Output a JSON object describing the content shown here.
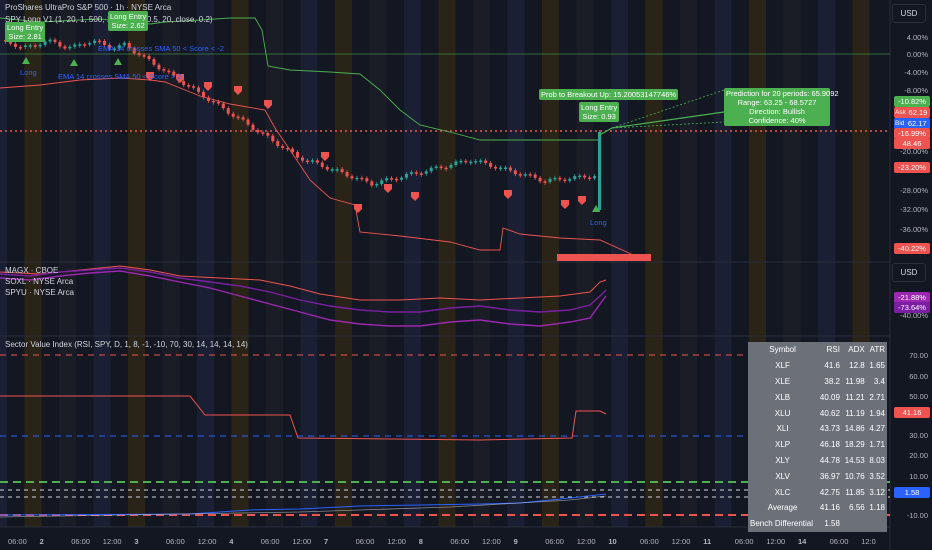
{
  "symbol_title": "ProShares UltraPro S&P 500 · 1h · NYSE Arca",
  "strategy_legend": "SPY Long V1 (1, 20, 1, 500, 14, 20, 14, 0.5, 20, close, 0.2)",
  "overlay_legend": [
    "MAGX · CBOE",
    "SOXL · NYSE Arca",
    "SPYU · NYSE Arca"
  ],
  "indicator_legend": "Sector Value Index (RSI, SPY, D, 1, 8, -1, -10, 70, 30, 14, 14, 14, 14)",
  "currency_label": "USD",
  "main_axis_ticks": [
    "4.00%",
    "0.00%",
    "-4.00%",
    "-8.00%",
    "-20.00%",
    "-24.00%",
    "-28.00%",
    "-32.00%",
    "-36.00%"
  ],
  "overlay_axis_ticks": [
    "-40.00%"
  ],
  "indicator_axis_ticks": [
    "70.00",
    "60.00",
    "50.00",
    "30.00",
    "20.00",
    "10.00",
    "0.00",
    "-10.00"
  ],
  "price_pills": [
    {
      "text": "-10.82%",
      "color": "#4caf50"
    },
    {
      "text": "62.19",
      "color": "#ef5350",
      "prefix": "Ask"
    },
    {
      "text": "62.17",
      "color": "#2962ff",
      "prefix": "Bid"
    },
    {
      "text": "-16.99%",
      "color": "#ef5350"
    },
    {
      "text": "48.46",
      "color": "#ef5350"
    },
    {
      "text": "-23.20%",
      "color": "#ef5350"
    },
    {
      "text": "-40.22%",
      "color": "#ef5350"
    }
  ],
  "overlay_pills": [
    {
      "text": "-21.88%",
      "color": "#9c27b0"
    },
    {
      "text": "-73.64%",
      "color": "#7b1fa2"
    }
  ],
  "indicator_pills": [
    {
      "text": "41.16",
      "color": "#ef5350"
    },
    {
      "text": "1.58",
      "color": "#2962ff"
    }
  ],
  "long_entry_boxes": [
    "Long Entry\nSize: 2.81",
    "Long Entry\nSize: 2.62",
    "Long Entry\nSize: 0.93"
  ],
  "prob_box": "Prob to Breakout Up: 15.20053147746%",
  "prediction_box": "Prediction for 20 periods: 65.9092\nRange: 63.25 - 68.5727\nDirection: Bullish\nConfidence: 40%",
  "chart_notes": [
    "EMA 14 crosses SMA 50 < Score > 2",
    "EMA 14 crosses SMA 50 < Score < -2",
    "Long",
    "Long"
  ],
  "time_labels": [
    "06:00",
    "2",
    "06:00",
    "12:00",
    "3",
    "06:00",
    "12:00",
    "4",
    "06:00",
    "12:00",
    "7",
    "06:00",
    "12:00",
    "8",
    "06:00",
    "12:00",
    "9",
    "06:00",
    "12:00",
    "10",
    "06:00",
    "12:00",
    "11",
    "06:00",
    "12:00",
    "14",
    "06:00",
    "12:0"
  ],
  "table": {
    "headers": [
      "Symbol",
      "RSI",
      "ADX",
      "ATR"
    ],
    "rows": [
      [
        "XLF",
        "41.6",
        "12.8",
        "1.65"
      ],
      [
        "XLE",
        "38.2",
        "11.98",
        "3.4"
      ],
      [
        "XLB",
        "40.09",
        "11.21",
        "2.71"
      ],
      [
        "XLU",
        "40.62",
        "11.19",
        "1.94"
      ],
      [
        "XLI",
        "43.73",
        "14.86",
        "4.27"
      ],
      [
        "XLP",
        "46.18",
        "18.29",
        "1.71"
      ],
      [
        "XLY",
        "44.78",
        "14.53",
        "8.03"
      ],
      [
        "XLV",
        "36.97",
        "10.76",
        "3.52"
      ],
      [
        "XLC",
        "42.75",
        "11.85",
        "3.12"
      ],
      [
        "Average",
        "41.16",
        "6.56",
        "1.18"
      ],
      [
        "Bench Differential",
        "1.58",
        "",
        ""
      ]
    ]
  },
  "colors": {
    "up": "#26a69a",
    "down": "#ef5350",
    "bg": "#131722",
    "grid": "#1e222d"
  }
}
